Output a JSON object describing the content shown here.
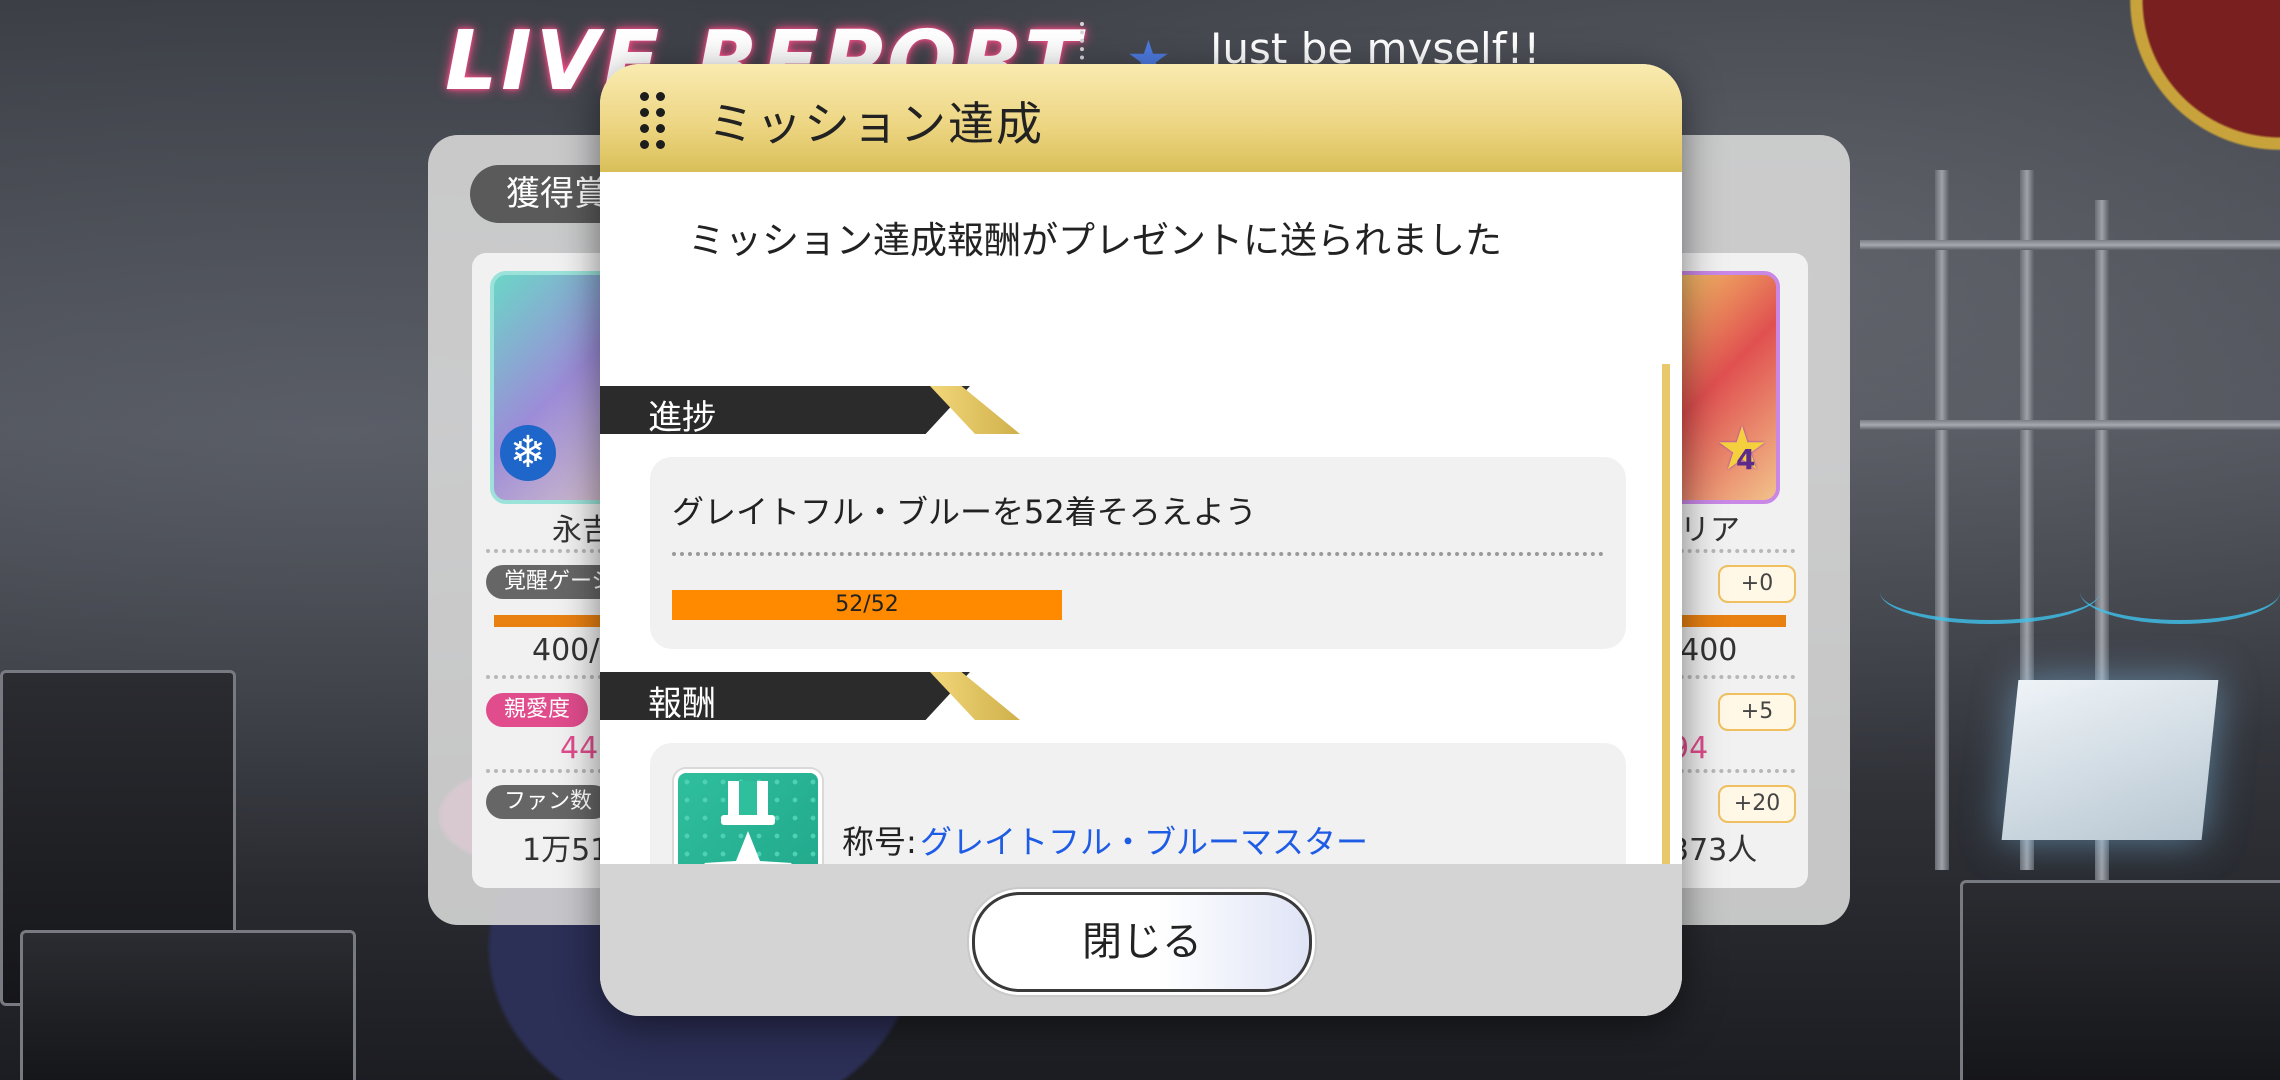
{
  "background": {
    "report_title": "LIVE REPORT",
    "song_title": "Just be myself!!",
    "song_icon": "blue-star-icon"
  },
  "result_card": {
    "tab_label": "獲得賞",
    "left_idol": {
      "name": "永吉",
      "stat_gauge_label": "覚醒ゲージ",
      "gauge_value": "400/",
      "affinity_label": "親愛度",
      "affinity_value": "44",
      "fans_label": "ファン数",
      "fans_value": "1万51",
      "attr_icon": "ice-crystal-icon"
    },
    "right_idol": {
      "name": "リア",
      "gauge_value": "/400",
      "gauge_bonus": "+0",
      "affinity_value": "94",
      "affinity_bonus": "+5",
      "fans_value": "373人",
      "fans_bonus": "+20",
      "rank_number": "4",
      "attr_icon": "star-icon"
    }
  },
  "modal": {
    "title": "ミッション達成",
    "message": "ミッション達成報酬がプレゼントに送られました",
    "progress_section": {
      "label": "進捗",
      "mission_text": "グレイトフル・ブルーを52着そろえよう",
      "progress_text": "52/52",
      "progress_fraction": 1.0
    },
    "reward_section": {
      "label": "報酬",
      "reward_prefix": "称号:",
      "reward_name": "グレイトフル・ブルーマスター",
      "reward_icon": "medal-star-icon"
    },
    "close_button": "閉じる"
  },
  "colors": {
    "accent_gold": "#ecd480",
    "progress_orange": "#ff8a00",
    "link_blue": "#1f5ce6",
    "section_dark": "#2b2b2b"
  }
}
